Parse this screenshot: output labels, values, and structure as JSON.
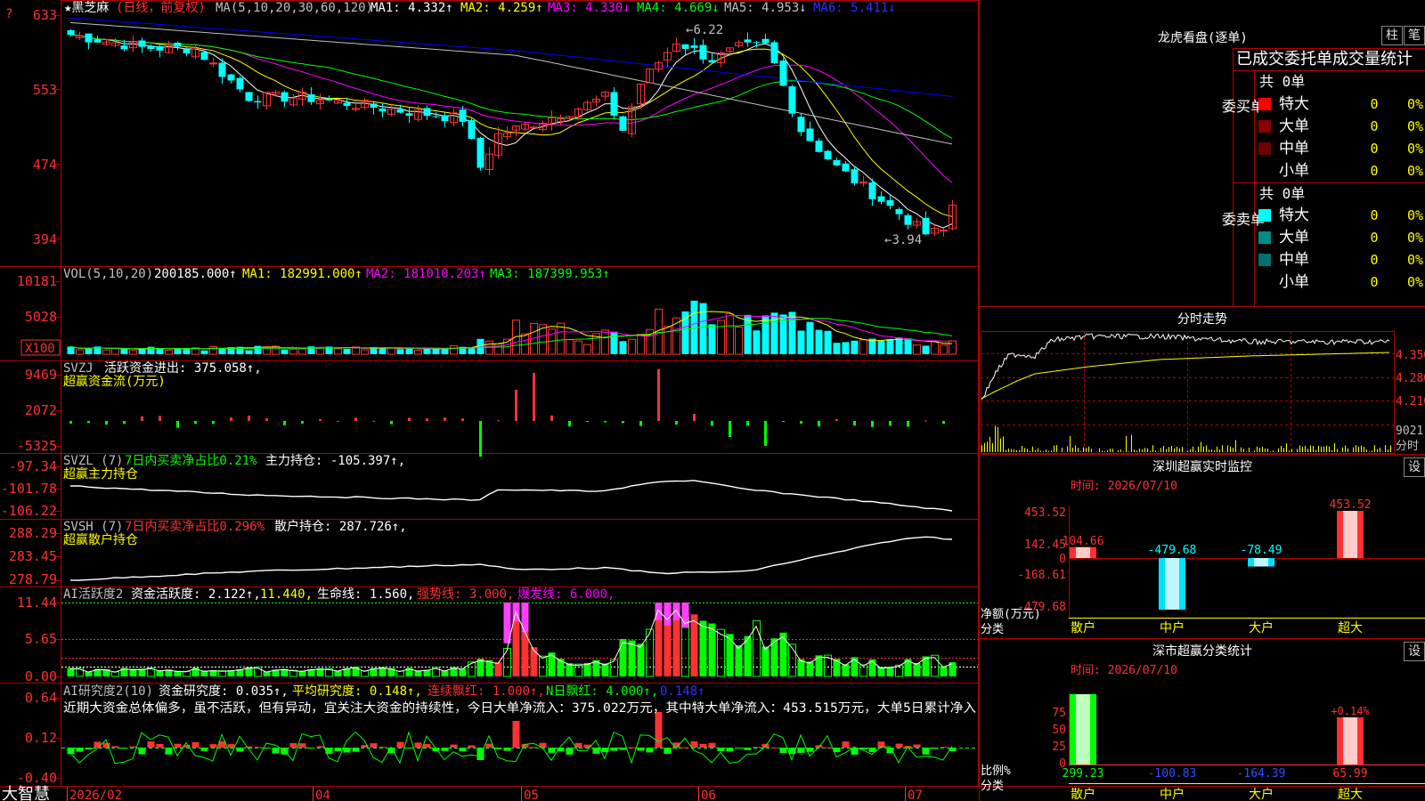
{
  "header": {
    "stock_name": "★黑芝麻",
    "period": "(日线，前复权)",
    "ma_def": "MA(5,10,20,30,60,120)",
    "ma1": "MA1: 4.332↑",
    "ma2": "MA2: 4.259↑",
    "ma3": "MA3: 4.330↓",
    "ma4": "MA4: 4.669↓",
    "ma5": "MA5: 4.953↓",
    "ma6": "MA6: 5.411↓",
    "corner_mark": "?"
  },
  "price_panel": {
    "y_ticks": [
      "633",
      "553",
      "474",
      "394"
    ],
    "high_label": "6.22",
    "low_label": "3.94"
  },
  "vol_panel": {
    "title": "VOL(5,10,20)",
    "value": "200185.000↑",
    "ma1": "MA1: 182991.000↑",
    "ma2": "MA2: 181010.203↑",
    "ma3": "MA3: 187399.953↑",
    "y_ticks": [
      "10181",
      "5028"
    ],
    "unit": "X100"
  },
  "svzj_panel": {
    "title": "SVZJ",
    "item": "活跃资金进出: 375.058↑,",
    "subtitle": "超赢资金流(万元)",
    "y_ticks": [
      "9469",
      "2072",
      "-5325"
    ]
  },
  "svzl_panel": {
    "title": "SVZL (7)",
    "item1": "7日内买卖净占比0.21%",
    "item2": "主力持仓: -105.397↑,",
    "subtitle": "超赢主力持仓",
    "y_ticks": [
      "-97.34",
      "-101.78",
      "-106.22"
    ]
  },
  "svsh_panel": {
    "title": "SVSH (7)",
    "item1": "7日内买卖净占比0.296%",
    "item2": "散户持仓: 287.726↑,",
    "subtitle": "超赢散户持仓",
    "y_ticks": [
      "288.29",
      "283.45",
      "278.79"
    ]
  },
  "ai_active_panel": {
    "title": "AI活跃度2",
    "item1": "资金活跃度: 2.122↑,",
    "item2": "11.440,",
    "item3": "生命线: 1.560,",
    "item4": "强势线: 3.000,",
    "item5": "爆发线: 6.000,",
    "y_ticks": [
      "11.44",
      "5.65",
      "0.00"
    ]
  },
  "ai_research_panel": {
    "title": "AI研究度2(10)",
    "item1": "资金研究度: 0.035↑,",
    "item2": "平均研究度: 0.148↑,",
    "item3": "连续飘红: 1.000↑,",
    "item4": "N日飘红: 4.000↑,",
    "item5": "0.148↑",
    "comment": "近期大资金总体偏多，虽不活跃，但有异动，宜关注大资金的持续性，今日大单净流入：375.022万元，其中特大单净流入：453.515万元，大单5日累计净入",
    "y_ticks": [
      "0.64",
      "0.12",
      "-0.40"
    ]
  },
  "time_axis": {
    "brand": "大智慧",
    "labels": [
      "2026/02",
      "04",
      "05",
      "06",
      "07"
    ]
  },
  "dragon_tiger": {
    "title": "龙虎看盘(逐单)",
    "btn_bar": "柱",
    "btn_pen": "笔",
    "header": "已成交委托单成交量统计",
    "buy_label": "委买单",
    "sell_label": "委卖单",
    "buy_total": "共 0单",
    "sell_total": "共 0单",
    "buy_rows": [
      {
        "label": "特大",
        "count": "0",
        "pct": "0%",
        "color": "#ff0000"
      },
      {
        "label": "大单",
        "count": "0",
        "pct": "0%",
        "color": "#8b0000"
      },
      {
        "label": "中单",
        "count": "0",
        "pct": "0%",
        "color": "#6e0000"
      },
      {
        "label": "小单",
        "count": "0",
        "pct": "0%",
        "color": ""
      }
    ],
    "sell_rows": [
      {
        "label": "特大",
        "count": "0",
        "pct": "0%",
        "color": "#00ffff"
      },
      {
        "label": "大单",
        "count": "0",
        "pct": "0%",
        "color": "#008b8b"
      },
      {
        "label": "中单",
        "count": "0",
        "pct": "0%",
        "color": "#007070"
      },
      {
        "label": "小单",
        "count": "0",
        "pct": "0%",
        "color": ""
      }
    ]
  },
  "intraday": {
    "title": "分时走势",
    "y_ticks": [
      "4.350",
      "4.280",
      "4.210"
    ],
    "vol_label": "9021",
    "unit_label": "分时"
  },
  "sz_monitor": {
    "title": "深圳超赢实时监控",
    "btn": "设",
    "time": "时间: 2026/07/10",
    "y_ticks": [
      "453.52",
      "142.45",
      "0",
      "-168.61",
      "-479.68"
    ],
    "y_title": "净额(万元)",
    "x_title": "分类",
    "categories": [
      "散户",
      "中户",
      "大户",
      "超大"
    ],
    "values": [
      104.66,
      -479.68,
      -78.49,
      453.52
    ],
    "value_labels": [
      "104.66",
      "-479.68",
      "-78.49",
      "453.52"
    ]
  },
  "sz_class": {
    "title": "深市超赢分类统计",
    "btn": "设",
    "time": "时间: 2026/07/10",
    "y_ticks": [
      "75",
      "50",
      "25",
      "0"
    ],
    "y_title": "比例%",
    "x_title": "分类",
    "categories": [
      "散户",
      "中户",
      "大户",
      "超大"
    ],
    "values": [
      299.23,
      -100.83,
      -164.39,
      65.99
    ],
    "value_labels": [
      "299.23",
      "-100.83",
      "-164.39",
      "65.99"
    ],
    "pct_label": "+0.14%"
  },
  "chart_data": [
    {
      "type": "candlestick",
      "title": "黑芝麻 日线 前复权",
      "ylim": [
        3.94,
        6.33
      ],
      "high": 6.22,
      "low": 3.94,
      "ma_series": [
        {
          "name": "MA1",
          "value": 4.332,
          "color": "#ffffff"
        },
        {
          "name": "MA2",
          "value": 4.259,
          "color": "#ffff00"
        },
        {
          "name": "MA3",
          "value": 4.33,
          "color": "#ff00ff"
        },
        {
          "name": "MA4",
          "value": 4.669,
          "color": "#00ff00"
        },
        {
          "name": "MA5",
          "value": 4.953,
          "color": "#c0c0c0"
        },
        {
          "name": "MA6",
          "value": 5.411,
          "color": "#0000ff"
        }
      ]
    },
    {
      "type": "bar",
      "title": "VOL(5,10,20)",
      "last_value": 200185.0,
      "ma": [
        182991.0,
        181010.203,
        187399.953
      ],
      "ylim": [
        0,
        10181
      ]
    },
    {
      "type": "bar",
      "title": "深圳超赢实时监控",
      "categories": [
        "散户",
        "中户",
        "大户",
        "超大"
      ],
      "values": [
        104.66,
        -479.68,
        -78.49,
        453.52
      ],
      "ylim": [
        -479.68,
        453.52
      ]
    },
    {
      "type": "bar",
      "title": "深市超赢分类统计",
      "categories": [
        "散户",
        "中户",
        "大户",
        "超大"
      ],
      "values": [
        299.23,
        -100.83,
        -164.39,
        65.99
      ]
    }
  ]
}
